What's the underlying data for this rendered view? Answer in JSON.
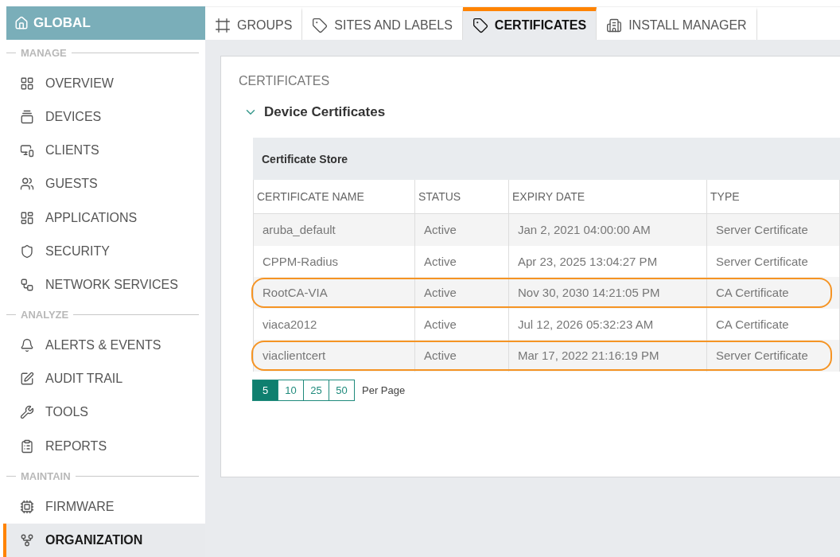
{
  "sidebar": {
    "header": {
      "label": "GLOBAL"
    },
    "sections": [
      {
        "title": "MANAGE",
        "items": [
          {
            "label": "OVERVIEW",
            "selected": false
          },
          {
            "label": "DEVICES",
            "selected": false
          },
          {
            "label": "CLIENTS",
            "selected": false
          },
          {
            "label": "GUESTS",
            "selected": false
          },
          {
            "label": "APPLICATIONS",
            "selected": false
          },
          {
            "label": "SECURITY",
            "selected": false
          },
          {
            "label": "NETWORK SERVICES",
            "selected": false
          }
        ]
      },
      {
        "title": "ANALYZE",
        "items": [
          {
            "label": "ALERTS & EVENTS",
            "selected": false
          },
          {
            "label": "AUDIT TRAIL",
            "selected": false
          },
          {
            "label": "TOOLS",
            "selected": false
          },
          {
            "label": "REPORTS",
            "selected": false
          }
        ]
      },
      {
        "title": "MAINTAIN",
        "items": [
          {
            "label": "FIRMWARE",
            "selected": false
          },
          {
            "label": "ORGANIZATION",
            "selected": true
          }
        ]
      }
    ]
  },
  "tabs": [
    {
      "label": "GROUPS",
      "selected": false
    },
    {
      "label": "SITES AND LABELS",
      "selected": false
    },
    {
      "label": "CERTIFICATES",
      "selected": true
    },
    {
      "label": "INSTALL MANAGER",
      "selected": false
    }
  ],
  "panel": {
    "title": "CERTIFICATES",
    "section": {
      "label": "Device Certificates",
      "expanded": true
    },
    "table": {
      "caption": "Certificate Store",
      "columns": [
        "CERTIFICATE NAME",
        "STATUS",
        "EXPIRY DATE",
        "TYPE"
      ],
      "rows": [
        {
          "cells": [
            "aruba_default",
            "Active",
            "Jan 2, 2021 04:00:00 AM",
            "Server Certificate"
          ],
          "highlighted": false
        },
        {
          "cells": [
            "CPPM-Radius",
            "Active",
            "Apr 23, 2025 13:04:27 PM",
            "Server Certificate"
          ],
          "highlighted": false
        },
        {
          "cells": [
            "RootCA-VIA",
            "Active",
            "Nov 30, 2030 14:21:05 PM",
            "CA Certificate"
          ],
          "highlighted": true
        },
        {
          "cells": [
            "viaca2012",
            "Active",
            "Jul 12, 2026 05:32:23 AM",
            "CA Certificate"
          ],
          "highlighted": false
        },
        {
          "cells": [
            "viaclientcert",
            "Active",
            "Mar 17, 2022 21:16:19 PM",
            "Server Certificate"
          ],
          "highlighted": true
        }
      ]
    },
    "pagination": {
      "sizes": [
        {
          "label": "5",
          "selected": true
        },
        {
          "label": "10",
          "selected": false
        },
        {
          "label": "25",
          "selected": false
        },
        {
          "label": "50",
          "selected": false
        }
      ],
      "label": "Per Page"
    }
  }
}
